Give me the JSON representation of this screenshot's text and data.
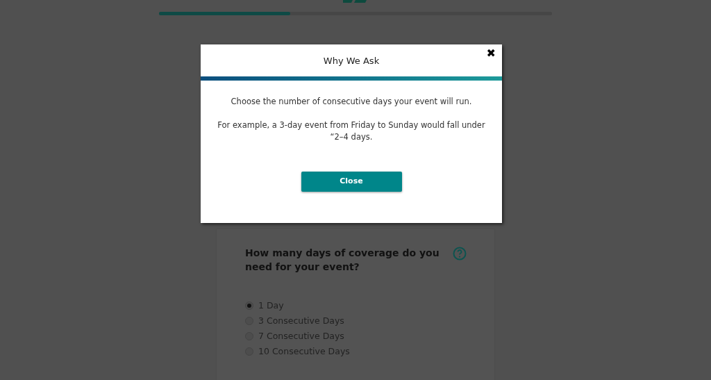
{
  "progress": {
    "level": 0.334
  },
  "question": {
    "text": "How many days of coverage do you need for your event?"
  },
  "options": [
    {
      "label": "1 Day",
      "selected": true
    },
    {
      "label": "3 Consecutive Days",
      "selected": false
    },
    {
      "label": "7 Consecutive Days",
      "selected": false
    },
    {
      "label": "10 Consecutive Days",
      "selected": false
    }
  ],
  "modal": {
    "title": "Why We Ask",
    "close_icon": "✖",
    "paragraphs": [
      "Choose the number of consecutive days your event will run.",
      "For example, a 3-day event from Friday to Sunday would fall under “2–4 days."
    ],
    "button": "Close"
  }
}
